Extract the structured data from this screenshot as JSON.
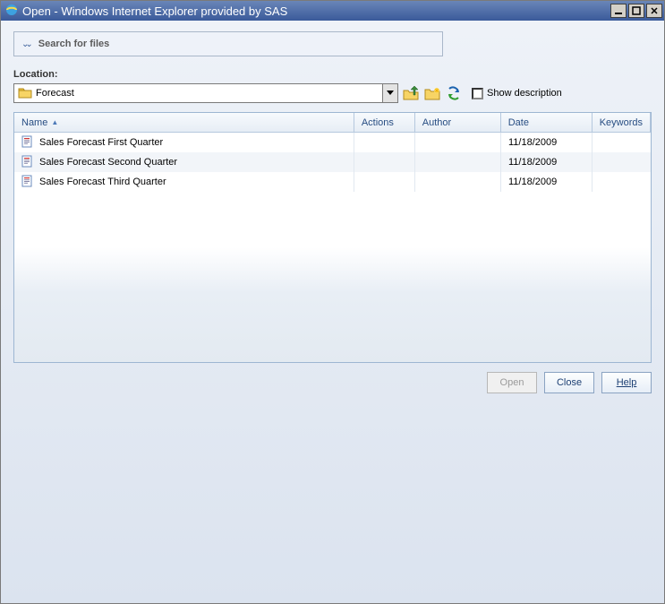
{
  "window": {
    "title": "Open - Windows Internet Explorer provided by SAS"
  },
  "search": {
    "placeholder": "Search for files"
  },
  "location": {
    "label": "Location:",
    "value": "Forecast",
    "show_desc_label": "Show description",
    "show_desc_checked": false
  },
  "columns": {
    "name": "Name",
    "actions": "Actions",
    "author": "Author",
    "date": "Date",
    "keywords": "Keywords",
    "sorted": "name",
    "sort_dir": "asc"
  },
  "rows": [
    {
      "name": "Sales Forecast First Quarter",
      "actions": "",
      "author": "",
      "date": "11/18/2009",
      "keywords": ""
    },
    {
      "name": "Sales Forecast Second Quarter",
      "actions": "",
      "author": "",
      "date": "11/18/2009",
      "keywords": ""
    },
    {
      "name": "Sales Forecast Third Quarter",
      "actions": "",
      "author": "",
      "date": "11/18/2009",
      "keywords": ""
    }
  ],
  "buttons": {
    "open": "Open",
    "close": "Close",
    "help": "Help"
  }
}
